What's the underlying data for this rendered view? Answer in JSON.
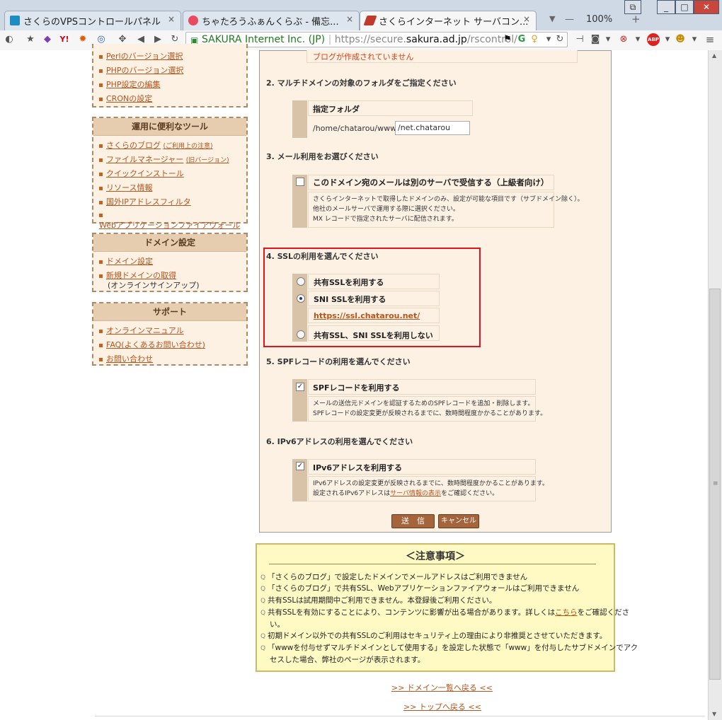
{
  "browser": {
    "tabs": [
      {
        "title": "さくらのVPSコントロールパネル",
        "favicon_color": "#1e8bc3",
        "active": false
      },
      {
        "title": "ちゃたろうふぁんくらぶ - 備忘...",
        "favicon_color": "#e84a5f",
        "active": false
      },
      {
        "title": "さくらインターネット サーバコン...",
        "favicon_color": "#c0392b",
        "active": true
      }
    ],
    "zoom": "100%",
    "close_glyph": "×",
    "url": {
      "secure_label": "SAKURA Internet Inc. (JP)",
      "prefix": "https://secure.",
      "host": "sakura.ad.jp",
      "path": "/rscontrol/"
    }
  },
  "sidebar": {
    "group0_items": [
      {
        "label": "Perlのバージョン選択"
      },
      {
        "label": "PHPのバージョン選択"
      },
      {
        "label": "PHP設定の編集"
      },
      {
        "label": "CRONの設定"
      }
    ],
    "group1": {
      "title": "運用に便利なツール",
      "items": [
        {
          "label": "さくらのブログ",
          "small": "(ご利用上の注意)"
        },
        {
          "label": "ファイルマネージャー",
          "small": "(旧バージョン)"
        },
        {
          "label": "クイックインストール"
        },
        {
          "label": "リソース情報"
        },
        {
          "label": "国外IPアドレスフィルタ"
        },
        {
          "label": "Webアプリケーションファイアウォール"
        }
      ]
    },
    "group2": {
      "title": "ドメイン設定",
      "items": [
        {
          "label": "ドメイン設定"
        },
        {
          "label": "新規ドメインの取得",
          "sub": "(オンラインサインアップ)"
        }
      ]
    },
    "group3": {
      "title": "サポート",
      "items": [
        {
          "label": "オンラインマニュアル"
        },
        {
          "label": "FAQ(よくあるお問い合わせ)"
        },
        {
          "label": "お問い合わせ"
        }
      ]
    }
  },
  "main": {
    "blog_note": "ブログが作成されていません",
    "sec2": {
      "title": "2. マルチドメインの対象のフォルダをご指定ください",
      "folder_label": "指定フォルダ",
      "folder_prefix": "/home/chatarou/www",
      "folder_value": "/net.chatarou"
    },
    "sec3": {
      "title": "3. メール利用をお選びください",
      "option": "このドメイン宛のメールは別のサーバで受信する（上級者向け）",
      "checked": false,
      "notes": [
        "さくらインターネットで取得したドメインのみ、設定が可能な項目です（サブドメイン除く）。",
        "他社のメールサーバで運用する際に選択ください。",
        "MX レコードで指定されたサーバに配信されます。"
      ]
    },
    "sec4": {
      "title": "4. SSLの利用を選んでください",
      "options": [
        {
          "label": "共有SSLを利用する",
          "selected": false
        },
        {
          "label": "SNI SSLを利用する",
          "selected": true
        },
        {
          "label": "共有SSL、SNI SSLを利用しない",
          "selected": false
        }
      ],
      "sni_url": "https://ssl.chatarou.net/"
    },
    "sec5": {
      "title": "5. SPFレコードの利用を選んでください",
      "option": "SPFレコードを利用する",
      "checked": true,
      "notes": [
        "メールの送信元ドメインを認証するためのSPFレコードを追加・削除します。",
        "SPFレコードの設定変更が反映されるまでに、数時間程度かかることがあります。"
      ]
    },
    "sec6": {
      "title": "6. IPv6アドレスの利用を選んでください",
      "option": "IPv6アドレスを利用する",
      "checked": true,
      "note1": "IPv6アドレスの設定変更が反映されるまでに、数時間程度かかることがあります。",
      "note2_prefix": "設定されるIPv6アドレスは",
      "note2_link": "サーバ情報の表示",
      "note2_suffix": "をご確認ください。"
    },
    "buttons": {
      "submit": "送　信",
      "cancel": "キャンセル"
    },
    "check_glyph": "✓"
  },
  "notice": {
    "title": "＜注意事項＞",
    "icon": "Q",
    "lines": [
      "「さくらのブログ」で設定したドメインでメールアドレスはご利用できません",
      "「さくらのブログ」で共有SSL、Webアプリケーションファイアウォールはご利用できません",
      "共有SSLは試用期間中ご利用できません。本登録後ご利用ください。"
    ],
    "line4_prefix": "共有SSLを有効にすることにより、コンテンツに影響が出る場合があります。詳しくは",
    "line4_link": "こちら",
    "line4_suffix": "をご確認くださ",
    "line4_cont": "い。",
    "line5": "初期ドメイン以外での共有SSLのご利用はセキュリティ上の理由により非推奨とさせていただきます。",
    "line6": "「wwwを付与せずマルチドメインとして使用する」を設定した状態で「www」を付与したサブドメインでアク",
    "line6_cont": "セスした場合、弊社のページが表示されます。"
  },
  "footer": {
    "domain_list": ">> ドメイン一覧へ戻る <<",
    "top": ">> トップへ戻る <<"
  }
}
